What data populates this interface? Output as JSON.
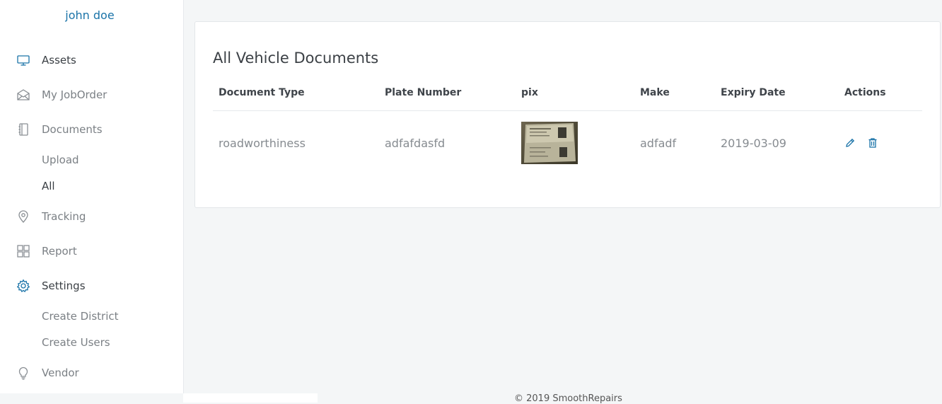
{
  "user": {
    "name": "john doe"
  },
  "nav": {
    "assets": {
      "label": "Assets",
      "icon": "monitor-icon"
    },
    "joborder": {
      "label": "My JobOrder",
      "icon": "envelope-open-icon"
    },
    "documents": {
      "label": "Documents",
      "icon": "notebook-icon",
      "sub": {
        "upload": "Upload",
        "all": "All"
      }
    },
    "tracking": {
      "label": "Tracking",
      "icon": "map-pin-icon"
    },
    "report": {
      "label": "Report",
      "icon": "grid-icon"
    },
    "settings": {
      "label": "Settings",
      "icon": "gear-icon",
      "sub": {
        "district": "Create District",
        "users": "Create Users"
      }
    },
    "vendor": {
      "label": "Vendor",
      "icon": "lightbulb-icon"
    }
  },
  "card": {
    "title": "All Vehicle Documents",
    "columns": [
      "Document Type",
      "Plate Number",
      "pix",
      "Make",
      "Expiry Date",
      "Actions"
    ],
    "rows": [
      {
        "document_type": "roadworthiness",
        "plate_number": "adfafdasfd",
        "make": "adfadf",
        "expiry_date": "2019-03-09"
      }
    ]
  },
  "footer": {
    "text": "© 2019 SmoothRepairs"
  },
  "colors": {
    "accent": "#1a73a8",
    "sidebar_bg": "#ffffff",
    "page_bg": "#f4f6f7"
  }
}
